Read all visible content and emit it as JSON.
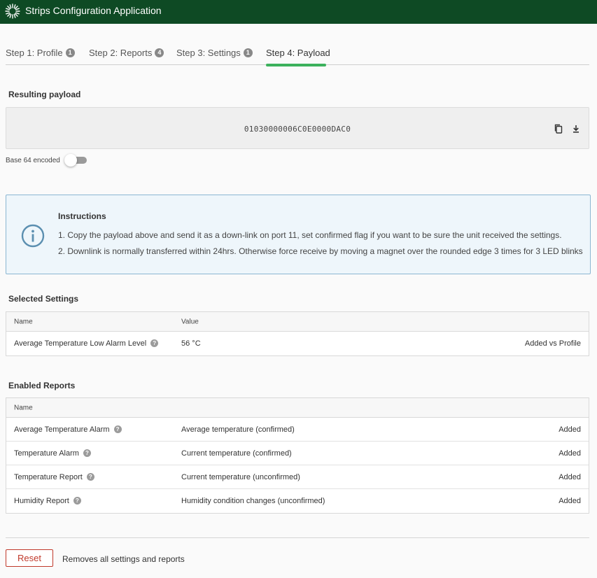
{
  "app": {
    "title": "Strips Configuration Application",
    "brand_color": "#0e4a24",
    "logo_icon": "sunburst-logo-icon"
  },
  "tabs": [
    {
      "label": "Step 1: Profile",
      "badge": "1",
      "active": false
    },
    {
      "label": "Step 2: Reports",
      "badge": "4",
      "active": false
    },
    {
      "label": "Step 3: Settings",
      "badge": "1",
      "active": false
    },
    {
      "label": "Step 4: Payload",
      "badge": "",
      "active": true
    }
  ],
  "accent_color": "#3cb15c",
  "payload": {
    "section_title": "Resulting payload",
    "value": "01030000006C0E0000DAC0",
    "copy_icon": "copy-icon",
    "download_icon": "download-icon",
    "base64_label": "Base 64 encoded",
    "base64_enabled": false
  },
  "instructions": {
    "icon": "info-icon",
    "title": "Instructions",
    "lines": [
      "1. Copy the payload above and send it as a down-link on port 11, set confirmed flag if you want to be sure the unit received the settings.",
      "2. Downlink is normally transferred within 24hrs. Otherwise force receive by moving a magnet over the rounded edge 3 times for 3 LED blinks"
    ]
  },
  "selected_settings": {
    "title": "Selected Settings",
    "headers": {
      "name": "Name",
      "value": "Value"
    },
    "rows": [
      {
        "name": "Average Temperature Low Alarm Level",
        "value": "56 °C",
        "status": "Added vs Profile"
      }
    ]
  },
  "enabled_reports": {
    "title": "Enabled Reports",
    "headers": {
      "name": "Name"
    },
    "rows": [
      {
        "name": "Average Temperature Alarm",
        "description": "Average temperature (confirmed)",
        "status": "Added"
      },
      {
        "name": "Temperature Alarm",
        "description": "Current temperature (confirmed)",
        "status": "Added"
      },
      {
        "name": "Temperature Report",
        "description": "Current temperature (unconfirmed)",
        "status": "Added"
      },
      {
        "name": "Humidity Report",
        "description": "Humidity condition changes (unconfirmed)",
        "status": "Added"
      }
    ]
  },
  "help_glyph": "?",
  "footer": {
    "reset_label": "Reset",
    "reset_description": "Removes all settings and reports",
    "reset_color": "#c0392b"
  }
}
